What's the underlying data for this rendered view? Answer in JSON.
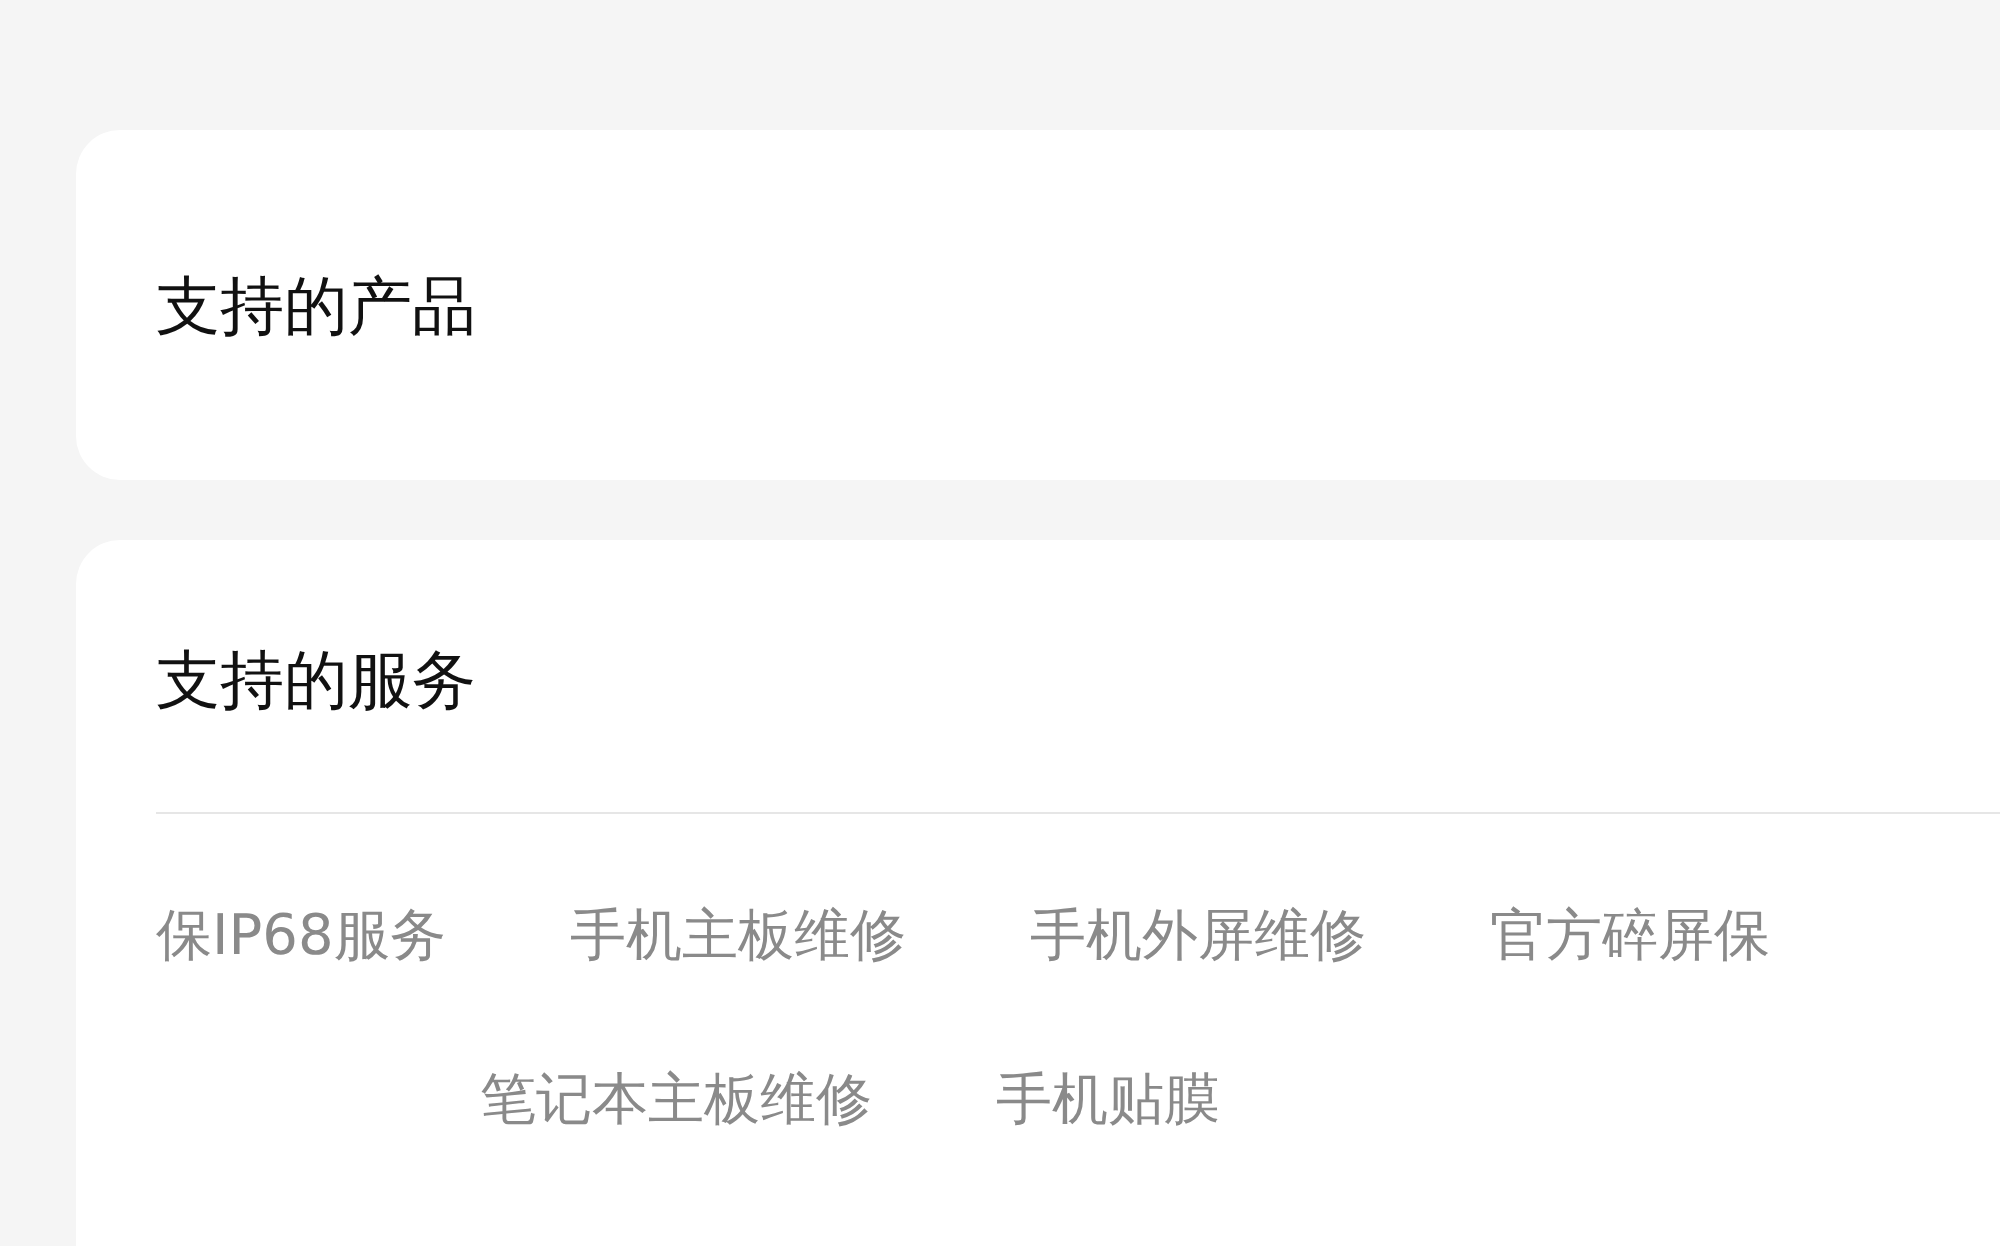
{
  "product_card": {
    "title": "支持的产品"
  },
  "service_card": {
    "title": "支持的服务",
    "services": [
      "保IP68服务",
      "手机主板维修",
      "手机外屏维修",
      "官方碎屏保",
      "笔记本主板维修",
      "手机贴膜"
    ]
  }
}
